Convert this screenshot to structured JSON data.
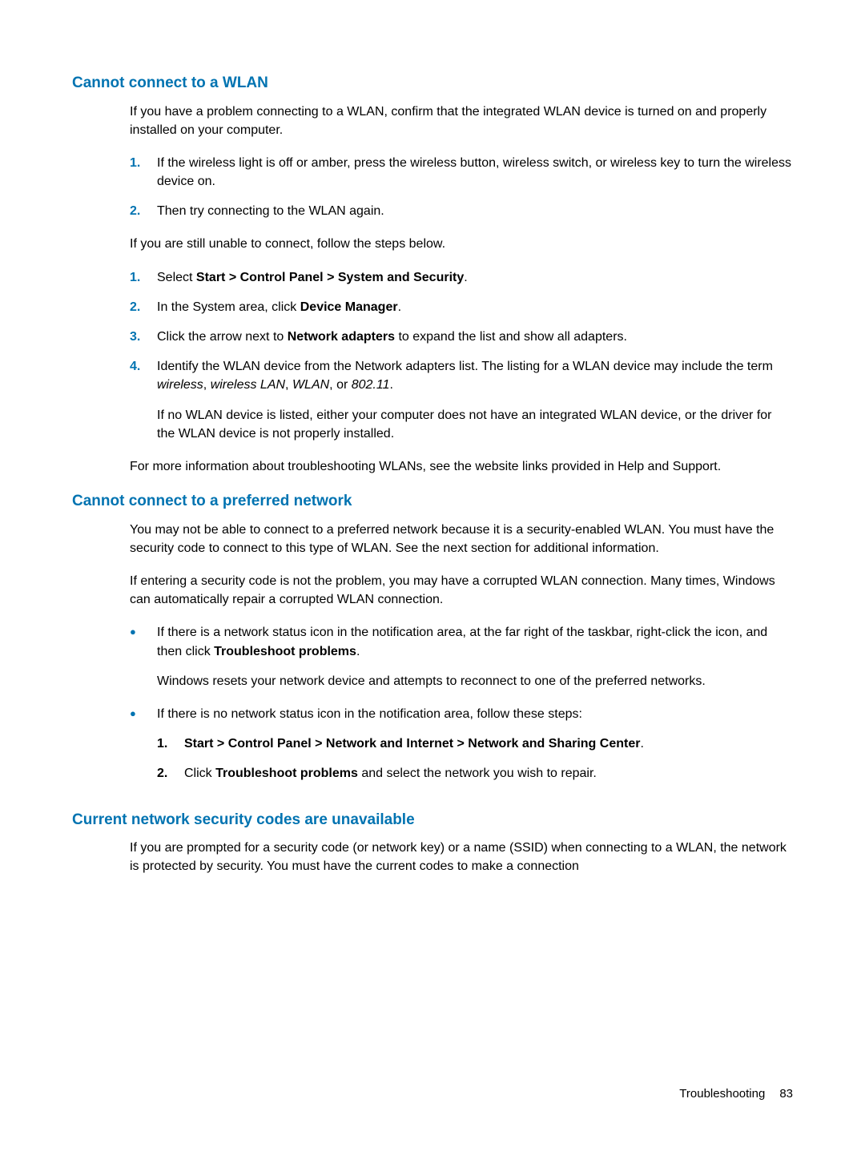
{
  "section1": {
    "heading": "Cannot connect to a WLAN",
    "intro": "If you have a problem connecting to a WLAN, confirm that the integrated WLAN device is turned on and properly installed on your computer.",
    "list1": {
      "m1": "1.",
      "t1": "If the wireless light is off or amber, press the wireless button, wireless switch, or wireless key to turn the wireless device on.",
      "m2": "2.",
      "t2": "Then try connecting to the WLAN again."
    },
    "still": "If you are still unable to connect, follow the steps below.",
    "list2": {
      "m1": "1.",
      "t1a": "Select ",
      "t1b": "Start > Control Panel > System and Security",
      "t1c": ".",
      "m2": "2.",
      "t2a": "In the System area, click ",
      "t2b": "Device Manager",
      "t2c": ".",
      "m3": "3.",
      "t3a": "Click the arrow next to ",
      "t3b": "Network adapters",
      "t3c": " to expand the list and show all adapters.",
      "m4": "4.",
      "t4a": "Identify the WLAN device from the Network adapters list. The listing for a WLAN device may include the term ",
      "t4b": "wireless",
      "t4c": ", ",
      "t4d": "wireless LAN",
      "t4e": ", ",
      "t4f": "WLAN",
      "t4g": ", or ",
      "t4h": "802.11",
      "t4i": ".",
      "t4sub": "If no WLAN device is listed, either your computer does not have an integrated WLAN device, or the driver for the WLAN device is not properly installed."
    },
    "close": "For more information about troubleshooting WLANs, see the website links provided in Help and Support."
  },
  "section2": {
    "heading": "Cannot connect to a preferred network",
    "p1": "You may not be able to connect to a preferred network because it is a security-enabled WLAN. You must have the security code to connect to this type of WLAN. See the next section for additional information.",
    "p2": "If entering a security code is not the problem, you may have a corrupted WLAN connection. Many times, Windows can automatically repair a corrupted WLAN connection.",
    "bullets": {
      "dot": "●",
      "b1a": "If there is a network status icon in the notification area, at the far right of the taskbar, right-click the icon, and then click ",
      "b1b": "Troubleshoot problems",
      "b1c": ".",
      "b1sub": "Windows resets your network device and attempts to reconnect to one of the preferred networks.",
      "b2": "If there is no network status icon in the notification area, follow these steps:",
      "sub": {
        "m1": "1.",
        "t1a": "Start > Control Panel > Network and Internet > Network and Sharing Center",
        "t1b": ".",
        "m2": "2.",
        "t2a": "Click ",
        "t2b": "Troubleshoot problems",
        "t2c": " and select the network you wish to repair."
      }
    }
  },
  "section3": {
    "heading": "Current network security codes are unavailable",
    "p1": "If you are prompted for a security code (or network key) or a name (SSID) when connecting to a WLAN, the network is protected by security. You must have the current codes to make a connection"
  },
  "footer": {
    "label": "Troubleshooting",
    "page": "83"
  }
}
